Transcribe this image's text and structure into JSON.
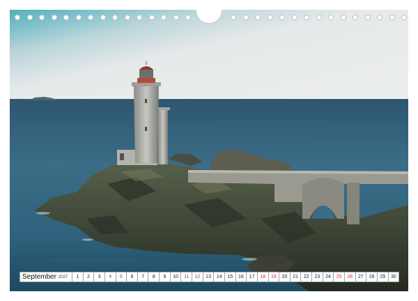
{
  "calendar": {
    "month": "September",
    "year": "2027",
    "days": [
      "1",
      "2",
      "3",
      "4",
      "5",
      "6",
      "7",
      "8",
      "9",
      "10",
      "11",
      "12",
      "13",
      "14",
      "15",
      "16",
      "17",
      "18",
      "19",
      "20",
      "21",
      "22",
      "23",
      "24",
      "25",
      "26",
      "27",
      "28",
      "29",
      "30"
    ],
    "sunday_indices": [
      3,
      4,
      10,
      11,
      17,
      18,
      24,
      25
    ],
    "sunday_color": "#c0392b"
  },
  "photo": {
    "subject": "lighthouse-on-rocky-islet-with-stone-bridge"
  },
  "colors": {
    "sea": "#2f5e78",
    "sky": "#e8ebec",
    "rock": "#3c4436"
  }
}
